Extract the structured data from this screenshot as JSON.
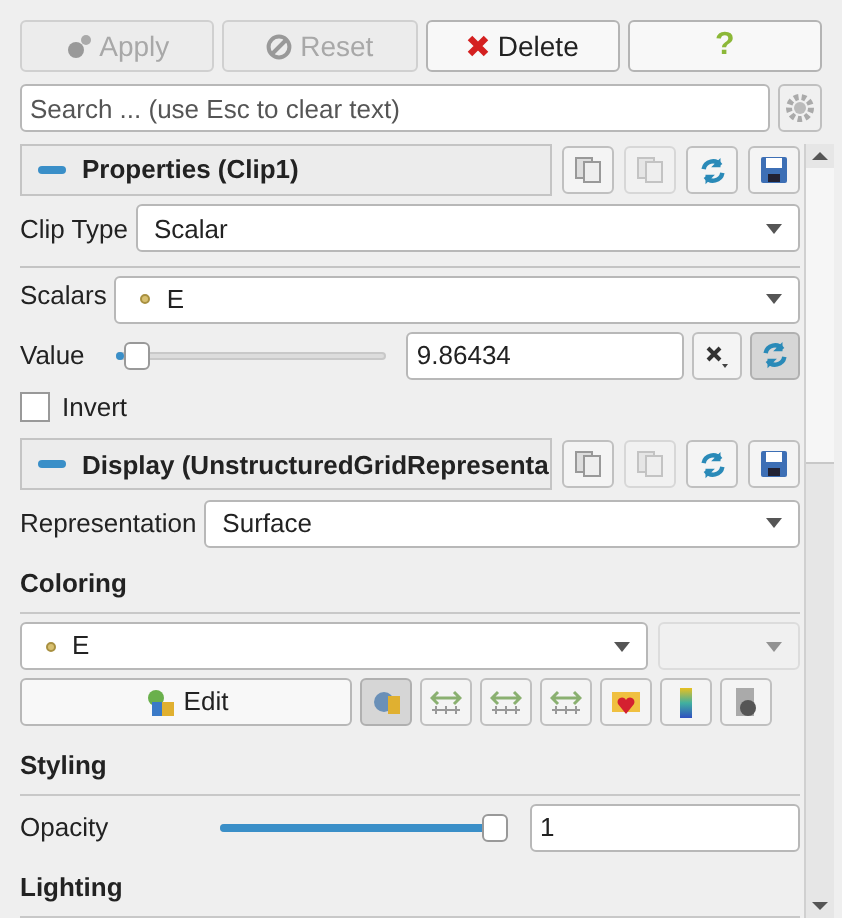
{
  "toolbar": [
    {
      "kind": "apply",
      "label": "Apply",
      "disabled": true
    },
    {
      "kind": "reset",
      "label": "Reset",
      "disabled": true
    },
    {
      "kind": "delete",
      "label": "Delete",
      "disabled": false
    },
    {
      "kind": "help",
      "label": "?",
      "disabled": false
    }
  ],
  "search": {
    "placeholder": "Search ... (use Esc to clear text)"
  },
  "properties": {
    "title": "Properties (Clip1)",
    "expanded": true,
    "clip_type": {
      "label": "Clip Type",
      "value": "Scalar"
    },
    "scalars": {
      "label": "Scalars",
      "value": "E"
    },
    "value": {
      "label": "Value",
      "level": 0.03,
      "text": "9.86434"
    },
    "invert": {
      "label": "Invert",
      "checked": false
    }
  },
  "display": {
    "title": "Display (UnstructuredGridRepresenta",
    "expanded": true,
    "representation": {
      "label": "Representation",
      "value": "Surface"
    },
    "coloring": {
      "heading": "Coloring",
      "array": "E",
      "edit_label": "Edit"
    },
    "styling": {
      "heading": "Styling",
      "opacity": {
        "label": "Opacity",
        "level": 1,
        "text": "1"
      }
    },
    "lighting": {
      "heading": "Lighting"
    }
  }
}
